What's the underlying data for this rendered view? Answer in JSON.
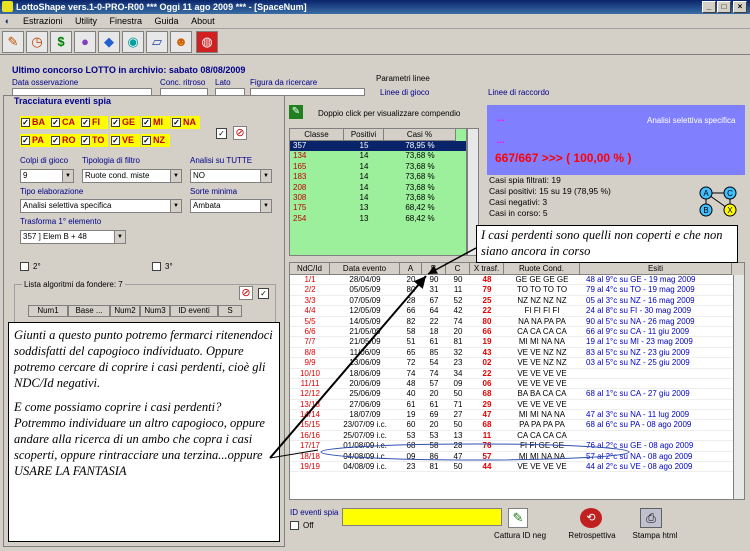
{
  "window": {
    "title": "LottoShape vers.1-0-PRO-R00   ***   Oggi 11 ago 2009   ***   - [SpaceNum]"
  },
  "menu": {
    "items": [
      "Estrazioni",
      "Utility",
      "Finestra",
      "Guida",
      "About"
    ]
  },
  "toolbar": {
    "icons": [
      "pencil-icon",
      "clock-icon",
      "dollar-icon",
      "bulb-icon",
      "cube-icon",
      "globe-icon",
      "ruler-icon",
      "people-icon",
      "stop-icon"
    ]
  },
  "header": {
    "last_draw": "Ultimo concorso LOTTO in archivio: sabato 08/08/2009",
    "fields": [
      "Data osservazione",
      "Conc. ritroso",
      "Lato",
      "Figura da ricercare"
    ],
    "params_title": "Parametri linee",
    "param_left": "Linee di gioco",
    "param_right": "Linee di raccordo"
  },
  "spy": {
    "title": "Tracciatura eventi spia",
    "wheels_row1": [
      "BA",
      "CA",
      "FI",
      "GE",
      "MI",
      "NA"
    ],
    "wheels_row2": [
      "PA",
      "RO",
      "TO",
      "VE",
      "NZ"
    ],
    "colpi_label": "Colpi di gioco",
    "colpi_value": "9",
    "tipologia_label": "Tipologia di filtro",
    "tipologia_value": "Ruote cond. miste",
    "analisi_label": "Analisi su TUTTE",
    "analisi_value": "NO",
    "tipo_label": "Tipo elaborazione",
    "tipo_value": "Analisi selettiva specifica",
    "sorte_label": "Sorte minima",
    "sorte_value": "Ambata",
    "trasforma_label": "Trasforma 1° elemento",
    "trasforma_value": "357 ] Elem B + 48",
    "second": "2°",
    "third": "3°",
    "list_label": "Lista algoritmi da fondere: 7",
    "list_headers": [
      "Num1",
      "Base ...",
      "Num2",
      "Num3",
      "ID eventi",
      "S"
    ]
  },
  "note1": [
    "Giunti a questo punto potremo fermarci ritenendoci soddisfatti del capogioco individuato. Oppure potremo cercare di coprire i casi perdenti, cioè gli NDC/Id negativi.",
    "E come possiamo coprire i casi perdenti? Potremmo individuare un altro capogioco, oppure andare alla ricerca di un ambo che copra i   casi scoperti, oppure rintracciare una terzina...oppure USARE LA FANTASIA"
  ],
  "note2": "I casi perdenti sono quelli non coperti e che non siano ancora in corso",
  "compendio": {
    "hint": "Doppio click per visualizzare compendio"
  },
  "class_table": {
    "headers": [
      "Classe",
      "Positivi",
      "Casi %"
    ],
    "rows": [
      [
        "357",
        "15",
        "78,95 %"
      ],
      [
        "134",
        "14",
        "73,68 %"
      ],
      [
        "165",
        "14",
        "73,68 %"
      ],
      [
        "183",
        "14",
        "73,68 %"
      ],
      [
        "208",
        "14",
        "73,68 %"
      ],
      [
        "308",
        "14",
        "73,68 %"
      ],
      [
        "175",
        "13",
        "68,42 %"
      ],
      [
        "254",
        "13",
        "68,42 %"
      ]
    ]
  },
  "summary": {
    "dots_top": "...",
    "mode": "Analisi selettiva specifica",
    "dots_mid": "...",
    "result": "667/667 >>> ( 100,00 % )"
  },
  "stats": [
    "Casi spia filtrati: 19",
    "Casi positivi: 15 su 19 (78,95 %)",
    "Casi negativi: 3",
    "Casi in corso: 5"
  ],
  "diagram": {
    "nodes": [
      "A",
      "B",
      "C",
      "X"
    ]
  },
  "events": {
    "headers": [
      "NdC/Id",
      "Data evento",
      "A",
      "B",
      "C",
      "X trasf.",
      "Ruote Cond.",
      "Esiti"
    ],
    "rows": [
      [
        "1/1",
        "28/04/09",
        "20",
        "90",
        "90",
        "48",
        "GE GE GE GE",
        "48 al 9°c su GE - 19 mag 2009"
      ],
      [
        "2/2",
        "05/05/09",
        "80",
        "31",
        "11",
        "79",
        "TO TO TO TO",
        "79 al 4°c su TO - 19 mag 2009"
      ],
      [
        "3/3",
        "07/05/09",
        "28",
        "67",
        "52",
        "25",
        "NZ NZ NZ NZ",
        "05 al 3°c su NZ - 16 mag 2009"
      ],
      [
        "4/4",
        "12/05/09",
        "66",
        "64",
        "42",
        "22",
        "FI FI FI FI",
        "24 al 8°c su FI - 30 mag 2009"
      ],
      [
        "5/5",
        "14/05/09",
        "82",
        "22",
        "74",
        "80",
        "NA NA PA PA",
        "90 al 5°c su NA - 26 mag 2009"
      ],
      [
        "6/6",
        "21/05/09",
        "58",
        "18",
        "20",
        "66",
        "CA CA CA CA",
        "66 al 9°c su CA - 11 giu 2009"
      ],
      [
        "7/7",
        "21/05/09",
        "51",
        "61",
        "81",
        "19",
        "MI MI NA NA",
        "19 al 1°c su MI - 23 mag 2009"
      ],
      [
        "8/8",
        "11/06/09",
        "65",
        "85",
        "32",
        "43",
        "VE VE NZ NZ",
        "83 al 5°c su NZ - 23 giu 2009"
      ],
      [
        "9/9",
        "13/06/09",
        "72",
        "54",
        "23",
        "02",
        "VE VE NZ NZ",
        "03 al 5°c su NZ - 25 giu 2009"
      ],
      [
        "10/10",
        "18/06/09",
        "74",
        "74",
        "34",
        "22",
        "VE VE VE VE",
        ""
      ],
      [
        "11/11",
        "20/06/09",
        "48",
        "57",
        "09",
        "06",
        "VE VE VE VE",
        ""
      ],
      [
        "12/12",
        "25/06/09",
        "40",
        "20",
        "50",
        "68",
        "BA BA CA CA",
        "68 al 1°c su CA - 27 giu 2009"
      ],
      [
        "13/13",
        "27/06/09",
        "61",
        "61",
        "71",
        "29",
        "VE VE VE VE",
        ""
      ],
      [
        "14/14",
        "18/07/09",
        "19",
        "69",
        "27",
        "47",
        "MI MI NA NA",
        "47 al 3°c su NA - 11 lug 2009"
      ],
      [
        "15/15",
        "23/07/09 i.c.",
        "60",
        "20",
        "50",
        "68",
        "PA PA PA PA",
        "68 al 6°c su PA - 08 ago 2009"
      ],
      [
        "16/16",
        "25/07/09 i.c.",
        "53",
        "53",
        "13",
        "11",
        "CA CA CA CA",
        ""
      ],
      [
        "17/17",
        "01/08/09 i.c.",
        "68",
        "58",
        "28",
        "76",
        "FI FI GE GE",
        "76 al 2°c su GE - 08 ago 2009"
      ],
      [
        "18/18",
        "04/08/09 i.c.",
        "09",
        "86",
        "47",
        "57",
        "MI MI NA NA",
        "57 al 2°c su NA - 08 ago 2009"
      ],
      [
        "19/19",
        "04/08/09 i.c.",
        "23",
        "81",
        "50",
        "44",
        "VE VE VE VE",
        "44 al 2°c su VE - 08 ago 2009"
      ]
    ]
  },
  "bottom": {
    "id_label": "ID eventi spia",
    "off_label": "Off",
    "cattura": "Cattura ID neg",
    "retro": "Retrospettiva",
    "stampa": "Stampa html"
  },
  "colors": {
    "titlebar": "#0a246a",
    "panel": "#d4d0c8",
    "summary_bg": "#8080ff",
    "positive": "#9cf09c",
    "negative": "#ff0000",
    "link": "#00008b",
    "highlight": "#ffff00"
  }
}
